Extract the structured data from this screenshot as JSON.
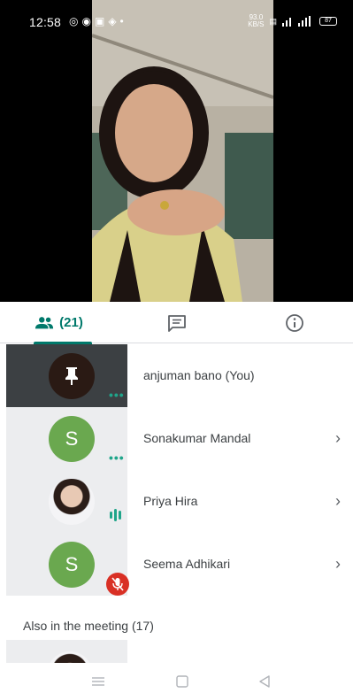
{
  "status_bar": {
    "time": "12:58",
    "left_icons": [
      "whatsapp-icon",
      "chrome-icon",
      "gmail-icon",
      "location-icon",
      "dot-icon"
    ],
    "net_speed": "93.0",
    "net_unit": "KB/S",
    "battery": "87"
  },
  "tabs": {
    "people_count": "(21)",
    "items": [
      "people-tab",
      "chat-tab",
      "info-tab"
    ],
    "active": "people"
  },
  "participants": [
    {
      "name": "anjuman bano (You)",
      "avatar": "pin-icon",
      "state": "dots",
      "has_chevron": false
    },
    {
      "name": "Sonakumar Mandal",
      "initial": "S",
      "state": "dots",
      "has_chevron": true
    },
    {
      "name": "Priya Hira",
      "avatar": "photo",
      "state": "speaking",
      "has_chevron": true
    },
    {
      "name": "Seema Adhikari",
      "initial": "S",
      "state": "muted",
      "has_chevron": true
    }
  ],
  "also_in_meeting": "Also in the meeting (17)",
  "colors": {
    "accent": "#00796b",
    "avatar_green": "#6aa84f",
    "muted_red": "#d93025",
    "activity_teal": "#1fa58a"
  }
}
